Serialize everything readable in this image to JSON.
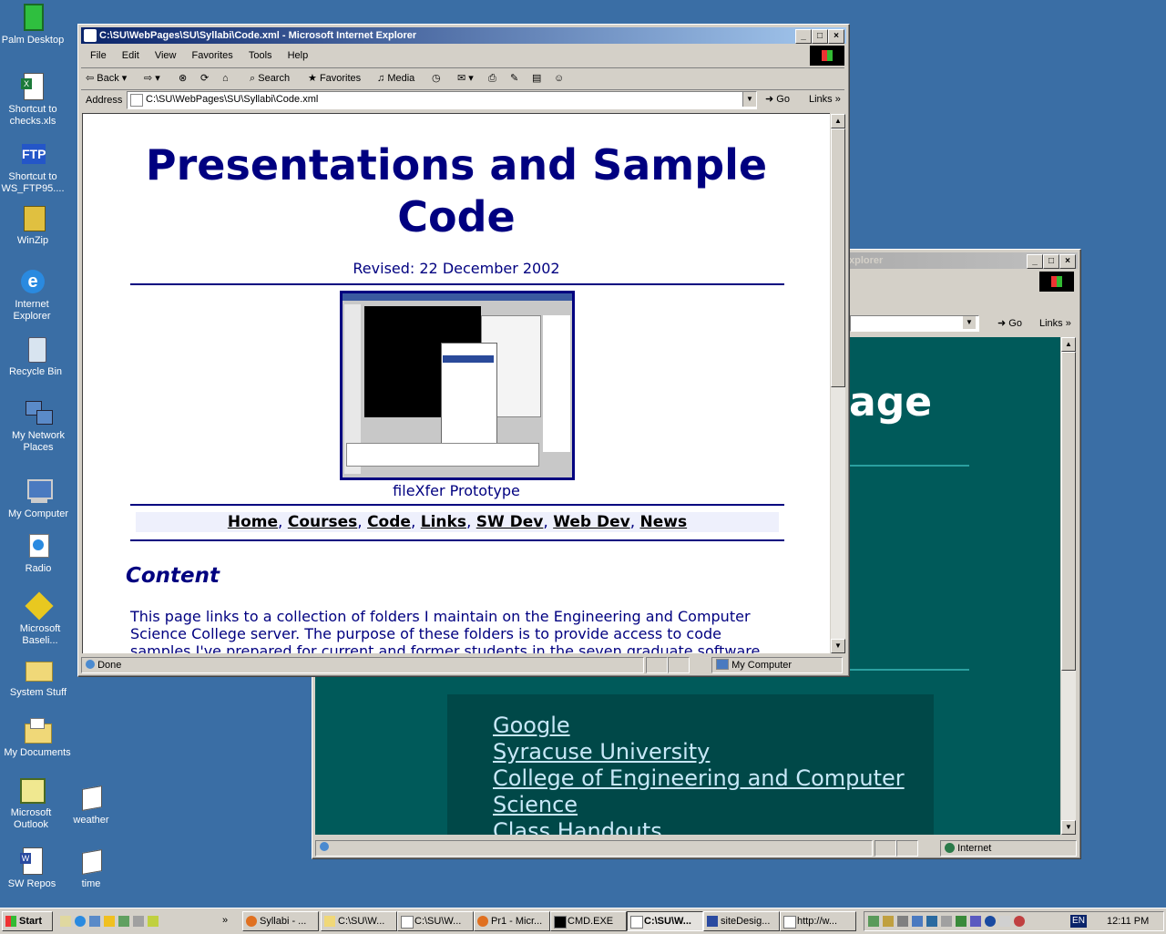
{
  "desktop": {
    "icons": [
      {
        "label": "Palm Desktop"
      },
      {
        "label": "Shortcut to checks.xls"
      },
      {
        "label": "Shortcut to WS_FTP95...."
      },
      {
        "label": "WinZip"
      },
      {
        "label": "Internet Explorer"
      },
      {
        "label": "Recycle Bin"
      },
      {
        "label": "My Network Places"
      },
      {
        "label": "My Computer"
      },
      {
        "label": "Radio"
      },
      {
        "label": "Microsoft Baseli..."
      },
      {
        "label": "System Stuff"
      },
      {
        "label": "My Documents"
      },
      {
        "label": "Microsoft Outlook"
      },
      {
        "label": "weather"
      },
      {
        "label": "SW Repos"
      },
      {
        "label": "time"
      }
    ]
  },
  "front_window": {
    "title": "C:\\SU\\WebPages\\SU\\Syllabi\\Code.xml - Microsoft Internet Explorer",
    "menu": [
      "File",
      "Edit",
      "View",
      "Favorites",
      "Tools",
      "Help"
    ],
    "toolbar": {
      "back": "Back",
      "search": "Search",
      "favorites": "Favorites",
      "media": "Media"
    },
    "address_label": "Address",
    "address_value": "C:\\SU\\WebPages\\SU\\Syllabi\\Code.xml",
    "go": "Go",
    "links": "Links",
    "page": {
      "heading_line1": "Presentations and Sample",
      "heading_line2": "Code",
      "revised": "Revised: 22 December 2002",
      "image_caption": "fileXfer Prototype",
      "nav": [
        "Home",
        "Courses",
        "Code",
        "Links",
        "SW Dev",
        "Web Dev",
        "News"
      ],
      "section_title": "Content",
      "paragraph": "This page links to a collection of folders I maintain on the Engineering and Computer Science College server. The purpose of these folders is to provide access to code samples I've prepared for current and former students in the seven graduate software"
    },
    "status": {
      "text": "Done",
      "zone": "My Computer"
    }
  },
  "back_window": {
    "title_fragment": "xplorer",
    "go": "Go",
    "links": "Links",
    "page": {
      "heading_fragment": "age",
      "links": [
        "Google",
        "Syracuse University",
        "College of Engineering and Computer",
        "Science",
        "Class Handouts"
      ]
    },
    "status": {
      "zone": "Internet"
    }
  },
  "taskbar": {
    "start": "Start",
    "tasks": [
      "Syllabi - ...",
      "C:\\SU\\W...",
      "C:\\SU\\W...",
      "Pr1 - Micr...",
      "CMD.EXE",
      "C:\\SU\\W...",
      "siteDesig...",
      "http://w..."
    ],
    "language": "EN",
    "clock": "12:11 PM"
  },
  "colors": {
    "desktop": "#3a6ea5",
    "title_active": "#0a246a",
    "page_text": "#000080",
    "teal_bg": "#005a5a"
  }
}
